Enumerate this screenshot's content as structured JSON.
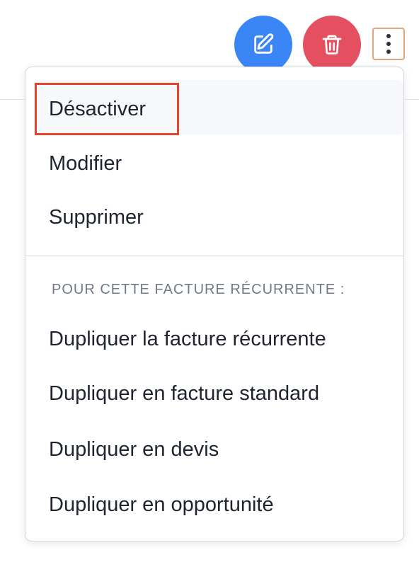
{
  "toolbar": {
    "edit_icon": "edit-icon",
    "delete_icon": "trash-icon",
    "more_icon": "more-vertical-icon",
    "edit_color": "#3b86f6",
    "delete_color": "#e4505f",
    "more_border_color": "#e3a57a"
  },
  "menu": {
    "items": [
      {
        "label": "Désactiver"
      },
      {
        "label": "Modifier"
      },
      {
        "label": "Supprimer"
      }
    ],
    "section_label": "POUR CETTE FACTURE RÉCURRENTE :",
    "section_items": [
      {
        "label": "Dupliquer la facture récurrente"
      },
      {
        "label": "Dupliquer en facture standard"
      },
      {
        "label": "Dupliquer en devis"
      },
      {
        "label": "Dupliquer en opportunité"
      }
    ],
    "highlight_color": "#e2442f"
  }
}
